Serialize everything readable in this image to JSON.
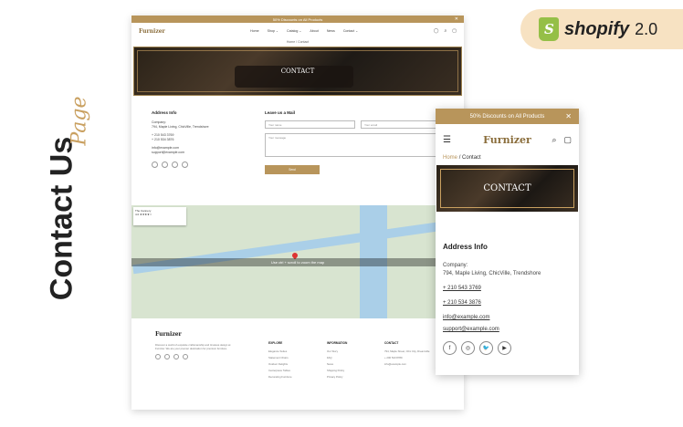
{
  "side": {
    "title": "Contact Us",
    "script": "Page"
  },
  "badge": {
    "brand": "shopify",
    "version": "2.0"
  },
  "desktop": {
    "announcement": "50% Discounts on All Products",
    "logo": "Furnizer",
    "nav": [
      "Home",
      "Shop ⌄",
      "Catalog ⌄",
      "About",
      "News",
      "Contact ⌄"
    ],
    "breadcrumb": "Home / Contact",
    "hero_title": "CONTACT",
    "address": {
      "heading": "Address Info",
      "company_label": "Company:",
      "company": "794, Maple Living, ChicVille, Trendshore",
      "phone1": "+ 210 543 3769",
      "phone2": "+ 210 534 3876",
      "email1": "info@example.com",
      "email2": "support@example.com"
    },
    "form": {
      "heading": "Leave us a Mail",
      "name_placeholder": "Your name",
      "email_placeholder": "Your email",
      "message_placeholder": "Your message",
      "button": "Send"
    },
    "map": {
      "card_title": "The Cannery",
      "card_rating": "4.0 ★★★★☆",
      "notice": "Use ctrl + scroll to zoom the map"
    },
    "footer": {
      "logo": "Furnizer",
      "description": "Discover a world of exquisite craftsmanship and timeless design at Furnizer. We are your premier destination for premium furniture.",
      "columns": [
        {
          "title": "EXPLORE",
          "items": [
            "Elegance Suites",
            "Statement Chairs",
            "Outdoor Delights",
            "Centerpiece Tables",
            "Decorating Furniture"
          ]
        },
        {
          "title": "INFORMATION",
          "items": [
            "Our Story",
            "FAQ",
            "News",
            "Shipping Policy",
            "Privacy Policy"
          ]
        },
        {
          "title": "CONTACT",
          "items": [
            "794, Maple Street, Chic City, Dreamville",
            "+ 200 543 8789",
            "info@example.com"
          ]
        }
      ]
    }
  },
  "mobile": {
    "announcement": "50% Discounts on All Products",
    "logo": "Furnizer",
    "breadcrumb_home": "Home",
    "breadcrumb_sep": "/",
    "breadcrumb_current": "Contact",
    "hero_title": "CONTACT",
    "address": {
      "heading": "Address Info",
      "company_label": "Company:",
      "company": "794, Maple Living, ChicVille, Trendshore",
      "phone1": "+ 210 543 3769",
      "phone2": "+ 210 534 3876",
      "email1": "info@example.com",
      "email2": "support@example.com"
    },
    "social": [
      "f",
      "◎",
      "🐦",
      "▶"
    ]
  }
}
